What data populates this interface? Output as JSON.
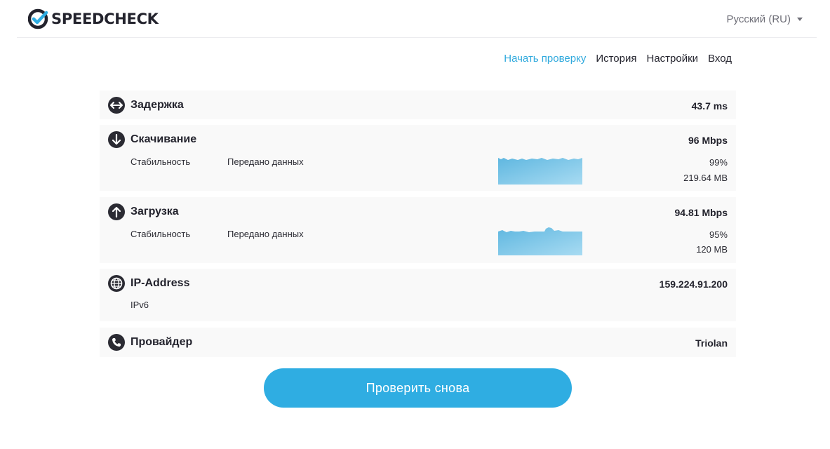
{
  "header": {
    "logo_text": "SPEEDCHECK",
    "language": "Русский (RU)"
  },
  "nav": {
    "items": [
      "Начать проверку",
      "История",
      "Настройки",
      "Вход"
    ]
  },
  "results": {
    "latency": {
      "label": "Задержка",
      "value": "43.7 ms",
      "icon": "arrows-horizontal-icon"
    },
    "download": {
      "label": "Скачивание",
      "value": "96 Mbps",
      "icon": "arrow-down-icon",
      "stability_label": "Стабильность",
      "transferred_label": "Передано данных",
      "stability_value": "99%",
      "transferred_value": "219.64 MB"
    },
    "upload": {
      "label": "Загрузка",
      "value": "94.81 Mbps",
      "icon": "arrow-up-icon",
      "stability_label": "Стабильность",
      "transferred_label": "Передано данных",
      "stability_value": "95%",
      "transferred_value": "120 MB"
    },
    "ip": {
      "label": "IP-Address",
      "value": "159.224.91.200",
      "sub_label": "IPv6",
      "icon": "globe-icon"
    },
    "provider": {
      "label": "Провайдер",
      "value": "Triolan",
      "icon": "phone-icon"
    }
  },
  "actions": {
    "retest_label": "Проверить снова"
  },
  "colors": {
    "accent": "#2fade2",
    "nav_active": "#2fa9dd",
    "dark": "#2b2b33",
    "card_bg": "#f9f9f9"
  }
}
